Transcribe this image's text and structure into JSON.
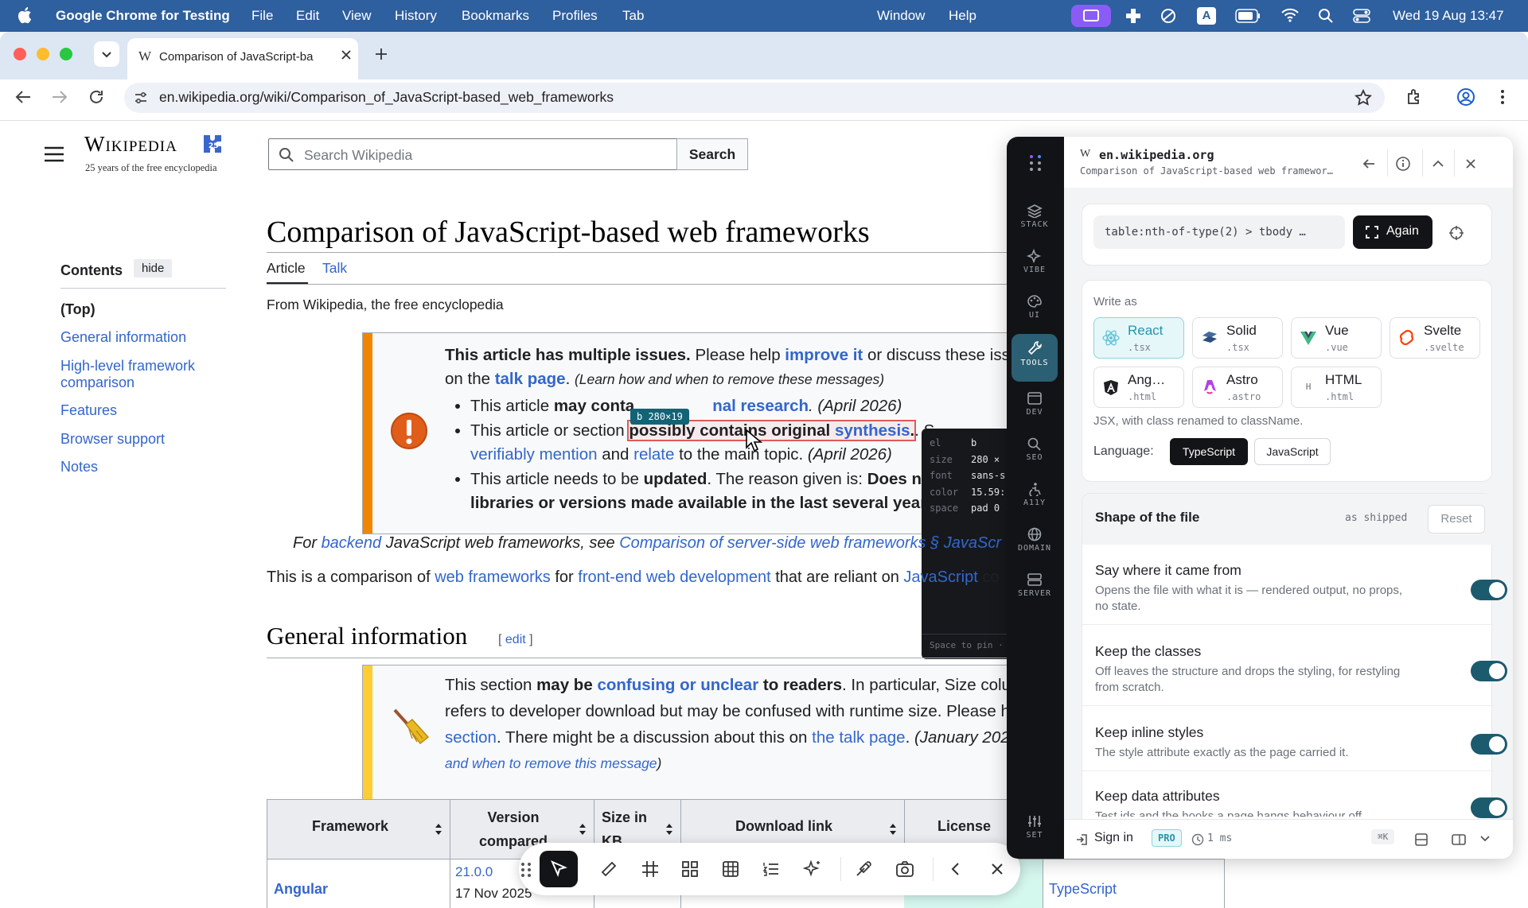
{
  "menubar": {
    "apple": "",
    "app": "Google Chrome for Testing",
    "items": [
      "File",
      "Edit",
      "View",
      "History",
      "Bookmarks",
      "Profiles",
      "Tab",
      "Window",
      "Help"
    ],
    "datetime": "Wed 19 Aug  13:47"
  },
  "browser": {
    "tab_title": "Comparison of JavaScript-ba",
    "url": "en.wikipedia.org/wiki/Comparison_of_JavaScript-based_web_frameworks"
  },
  "wiki": {
    "logo_title": "Wikipedia",
    "logo_tagline": "25 years of the free encyclopedia",
    "search_placeholder": "Search Wikipedia",
    "search_button": "Search",
    "page_title": "Comparison of JavaScript-based web frameworks",
    "tabs": [
      "Article",
      "Talk"
    ],
    "from": "From Wikipedia, the free encyclopedia",
    "contents": {
      "heading": "Contents",
      "hide": "hide",
      "items": [
        "(Top)",
        "General information",
        "High-level framework comparison",
        "Features",
        "Browser support",
        "Notes"
      ]
    },
    "issues": {
      "line1_bold": "This article has multiple issues.",
      "line1_a": " Please help ",
      "line1_link": "improve it",
      "line1_b": " or discuss these iss",
      "line2_a": "on the ",
      "line2_link": "talk page",
      "line2_b": ". ",
      "line2_italic": "(Learn how and when to remove these messages)",
      "b1_a": "This article ",
      "b1_bold": "may conta",
      "b1_link": "nal research",
      "b1_date": ". (April 2026)",
      "b2_a": "This article or section ",
      "b2_link1": "possibly contains original",
      "b2_link2": "synthesis",
      "b2_b": ". S",
      "b3_link1": "verifiably mention",
      "b3_and": " and ",
      "b3_link2": "relate",
      "b3_b": " to the main topic. ",
      "b3_date": "(April 2026)",
      "b4_a": "This article needs to be ",
      "b4_bold": "updated",
      "b4_b": ". The reason given is: ",
      "b4_bold2": "Does no",
      "b5_bold": "libraries or versions made available in the last several year"
    },
    "hatnote": {
      "a": "For ",
      "link1": "backend",
      "b": " JavaScript web frameworks, see ",
      "link2": "Comparison of server-side web frameworks § JavaScr"
    },
    "intro": {
      "a": "This is a comparison of ",
      "link1": "web frameworks",
      "b": " for ",
      "link2": "front-end web development",
      "c": " that are reliant on ",
      "link3": "JavaScript",
      "d": " co"
    },
    "section_title": "General information",
    "section_edit": "edit",
    "cleanup": {
      "l1_a": "This section ",
      "l1_bold": "may be ",
      "l1_link": "confusing or unclear",
      "l1_bold2": " to readers",
      "l1_b": ". In particular, Size colu",
      "l2": "refers to developer download but may be confused with runtime size. Please h",
      "l3_link": "section",
      "l3_a": ". There might be a discussion about this on ",
      "l3_link2": "the talk page",
      "l3_b": ". ",
      "l3_italic": "(January 202",
      "l4_italic": "and when to remove this message",
      "l4_end": ")"
    },
    "table": {
      "headers": [
        "Framework",
        "Version compared",
        "Size in KB",
        "Download link",
        "License"
      ],
      "row1": {
        "framework": "Angular",
        "version": "21.0.0",
        "date": "17 Nov 2025",
        "language": "TypeScript"
      }
    },
    "inspector": {
      "tag_badge": "b 280×19",
      "rows": [
        [
          "el",
          "b"
        ],
        [
          "size",
          "280 ×"
        ],
        [
          "font",
          "sans-s"
        ],
        [
          "color",
          "15.59:"
        ],
        [
          "space",
          "pad 0"
        ]
      ],
      "hint": "Space to pin ·"
    }
  },
  "panel": {
    "domain": "en.wikipedia.org",
    "page": "Comparison of JavaScript-based web framewor…",
    "rail": [
      "STACK",
      "VIBE",
      "UI",
      "TOOLS",
      "DEV",
      "SEO",
      "A11Y",
      "DOMAIN",
      "SERVER"
    ],
    "rail_bottom": "SET",
    "selector": "table:nth-of-type(2) > tbody …",
    "again": "Again",
    "write_as": "Write as",
    "frameworks": [
      {
        "name": "React",
        "ext": ".tsx"
      },
      {
        "name": "Solid",
        "ext": ".tsx"
      },
      {
        "name": "Vue",
        "ext": ".vue"
      },
      {
        "name": "Svelte",
        "ext": ".svelte"
      },
      {
        "name": "Ang…",
        "ext": ".html"
      },
      {
        "name": "Astro",
        "ext": ".astro"
      },
      {
        "name": "HTML",
        "ext": ".html"
      }
    ],
    "jsx_note": "JSX, with class renamed to className.",
    "language_label": "Language:",
    "languages": [
      "TypeScript",
      "JavaScript"
    ],
    "shape_title": "Shape of the file",
    "as_shipped": "as shipped",
    "reset": "Reset",
    "options": [
      {
        "title": "Say where it came from",
        "desc": "Opens the file with what it is — rendered output, no props, no state."
      },
      {
        "title": "Keep the classes",
        "desc": "Off leaves the structure and drops the styling, for restyling from scratch."
      },
      {
        "title": "Keep inline styles",
        "desc": "The style attribute exactly as the page carried it."
      },
      {
        "title": "Keep data attributes",
        "desc": "Test ids and the hooks a page hangs behaviour off."
      }
    ],
    "footer": {
      "signin": "Sign in",
      "pro": "PRO",
      "time": "1 ms",
      "kbd": "⌘K"
    }
  },
  "colors": {
    "menubar": "#2e5f9e",
    "accent": "#1c5a6e",
    "wiki_link": "#3366cc",
    "issue_orange": "#f28500",
    "issue_yellow": "#fc3"
  }
}
